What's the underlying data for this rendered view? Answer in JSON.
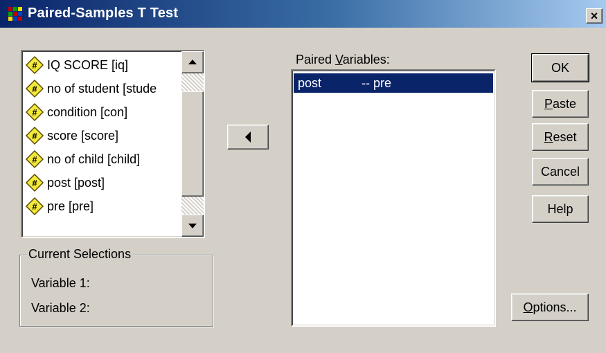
{
  "window": {
    "title": "Paired-Samples T Test",
    "close_glyph": "×"
  },
  "variables": {
    "items": [
      {
        "label": "IQ SCORE [iq]",
        "icon": "numeric-variable-icon"
      },
      {
        "label": "no of student [stude",
        "icon": "numeric-variable-icon"
      },
      {
        "label": "condition [con]",
        "icon": "numeric-variable-icon"
      },
      {
        "label": "score [score]",
        "icon": "numeric-variable-icon"
      },
      {
        "label": "no of child [child]",
        "icon": "numeric-variable-icon"
      },
      {
        "label": "post [post]",
        "icon": "numeric-variable-icon"
      },
      {
        "label": "pre [pre]",
        "icon": "numeric-variable-icon"
      }
    ]
  },
  "current_selections": {
    "title": "Current Selections",
    "variable1_label": "Variable 1:",
    "variable2_label": "Variable 2:"
  },
  "paired": {
    "label_prefix": "Paired ",
    "label_mnemonic": "V",
    "label_suffix": "ariables:",
    "pairs": [
      {
        "first": "post",
        "second": "-- pre",
        "selected": true
      }
    ]
  },
  "buttons": {
    "ok": {
      "label": "OK"
    },
    "paste": {
      "mnemonic": "P",
      "rest": "aste"
    },
    "reset": {
      "mnemonic": "R",
      "rest": "eset"
    },
    "cancel": {
      "label": "Cancel"
    },
    "help": {
      "label": "Help"
    },
    "options": {
      "mnemonic": "O",
      "rest": "ptions..."
    }
  },
  "colors": {
    "face": "#d4d0c8",
    "selection": "#0a246a",
    "title_start": "#0a246a",
    "title_end": "#a6caf0",
    "icon_fill": "#f3e93b"
  }
}
